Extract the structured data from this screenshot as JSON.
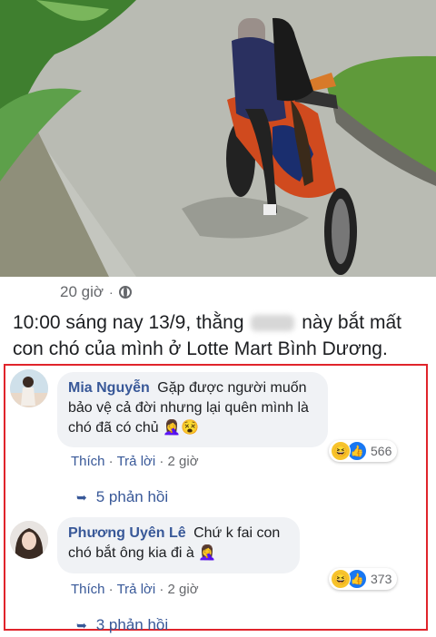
{
  "post": {
    "time": "20 giờ",
    "dot": "·",
    "text_before": "10:00 sáng nay 13/9, thằng",
    "text_after": "này bắt mất con chó của mình ở Lotte Mart Bình Dương."
  },
  "comments": [
    {
      "author": "Mia Nguyễn",
      "text": "Gặp được người muốn bảo vệ cả đời nhưng lại quên mình là chó đã có chủ 🤦‍♀️😵",
      "like_label": "Thích",
      "reply_label": "Trả lời",
      "time": "2 giờ",
      "reaction_count": "566",
      "replies_label": "5 phản hồi"
    },
    {
      "author": "Phương Uyên Lê",
      "text": "Chứ k fai con chó bắt ông kia đi à 🤦‍♀️",
      "like_label": "Thích",
      "reply_label": "Trả lời",
      "time": "2 giờ",
      "reaction_count": "373",
      "replies_label": "3 phản hồi"
    }
  ],
  "icons": {
    "globe": "globe-icon",
    "haha": "haha-reaction-icon",
    "like": "like-reaction-icon",
    "reply_arrow": "reply-arrow-icon"
  },
  "colors": {
    "link": "#385898",
    "highlight_border": "#e0242b",
    "bubble": "#f0f2f5"
  }
}
